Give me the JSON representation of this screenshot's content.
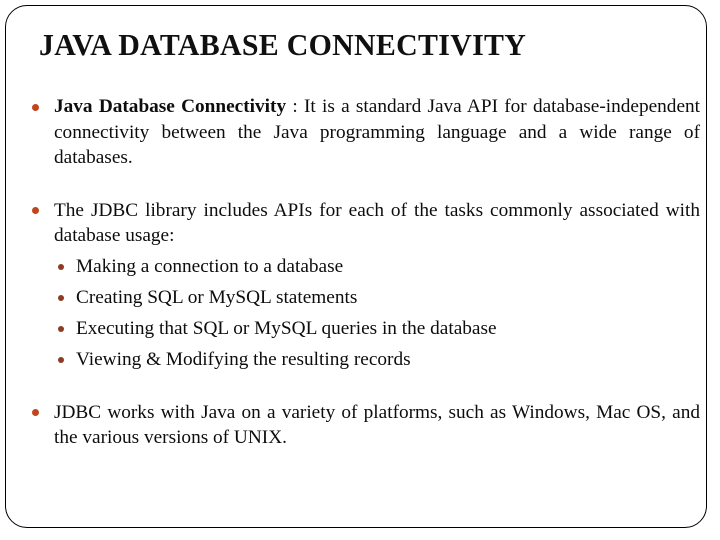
{
  "slide": {
    "title": "JAVA DATABASE CONNECTIVITY",
    "colors": {
      "background": "#ffffff",
      "border": "#000000",
      "title_text": "#101010",
      "body_text": "#0d0d0d",
      "bullet_level1": "#c0441e",
      "bullet_level2": "#8e3a24"
    },
    "bullets": [
      {
        "level": 1,
        "emphasis": "Java Database Connectivity",
        "text": " : It is a standard Java API for database-independent connectivity between the Java programming language and a wide range of databases."
      },
      {
        "level": 1,
        "text": "The JDBC library includes APIs for each of the tasks commonly associated with database usage:"
      },
      {
        "level": 2,
        "text": "Making a connection to a database"
      },
      {
        "level": 2,
        "text": "Creating SQL or MySQL statements"
      },
      {
        "level": 2,
        "text": "Executing that SQL or MySQL queries in the database"
      },
      {
        "level": 2,
        "text": "Viewing & Modifying the resulting records"
      },
      {
        "level": 1,
        "text": "JDBC works with Java on a variety of platforms, such as Windows, Mac OS, and the various versions of UNIX."
      }
    ]
  }
}
